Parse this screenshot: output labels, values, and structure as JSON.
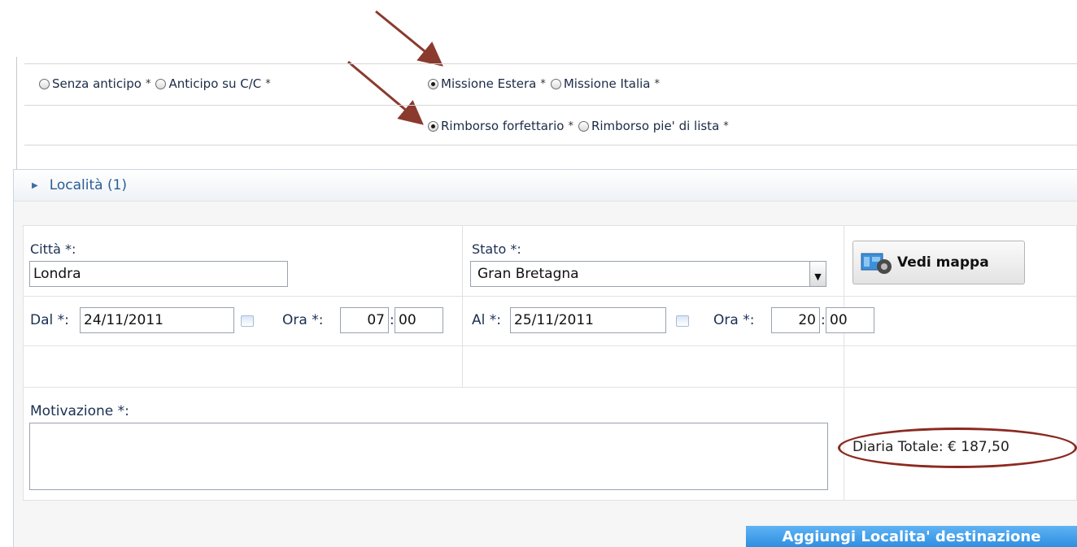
{
  "top_options": {
    "anticipo": [
      {
        "label": "Senza anticipo",
        "req": "*",
        "checked": false
      },
      {
        "label": "Anticipo su C/C",
        "req": "*",
        "checked": false
      }
    ],
    "missione": [
      {
        "label": "Missione Estera",
        "req": "*",
        "checked": true
      },
      {
        "label": "Missione Italia",
        "req": "*",
        "checked": false
      }
    ],
    "rimborso": [
      {
        "label": "Rimborso forfettario",
        "req": "*",
        "checked": true
      },
      {
        "label": "Rimborso pie' di lista",
        "req": "*",
        "checked": false
      }
    ]
  },
  "section": {
    "title": "Località (1)"
  },
  "form": {
    "citta_label": "Città *:",
    "citta_value": "Londra",
    "stato_label": "Stato *:",
    "stato_value": "Gran Bretagna",
    "map_button": "Vedi mappa",
    "dal_label": "Dal *:",
    "dal_value": "24/11/2011",
    "ora1_label": "Ora *:",
    "ora1_hh": "07",
    "ora1_mm": "00",
    "al_label": "Al *:",
    "al_value": "25/11/2011",
    "ora2_label": "Ora *:",
    "ora2_hh": "20",
    "ora2_mm": "00",
    "time_sep": ":",
    "motivazione_label": "Motivazione *:",
    "motivazione_value": "",
    "diaria": "Diaria Totale: € 187,50",
    "add_button": "Aggiungi Localita' destinazione"
  },
  "colors": {
    "annotation": "#8b2a20",
    "accent": "#2f8fe0"
  }
}
